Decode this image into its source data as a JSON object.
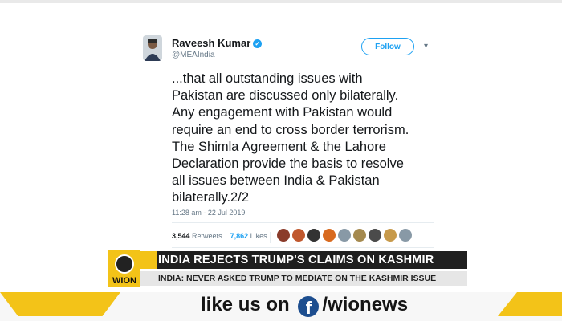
{
  "tweet": {
    "author_name": "Raveesh Kumar",
    "handle": "@MEAIndia",
    "follow_label": "Follow",
    "body_lines": [
      "...that all outstanding issues with",
      "Pakistan are discussed only bilaterally.",
      "Any engagement with Pakistan would",
      "require an end to cross border terrorism.",
      "The Shimla Agreement & the Lahore",
      "Declaration provide the basis to resolve",
      "all issues between India & Pakistan",
      "bilaterally.2/2"
    ],
    "timestamp": "11:28 am - 22 Jul 2019",
    "retweets_count": "3,544",
    "retweets_label": "Retweets",
    "likes_count": "7,862",
    "likes_label": "Likes",
    "icons": {
      "verified": "verified-badge-icon",
      "caret": "chevron-down-icon"
    },
    "liker_colors": [
      "#8a3b2a",
      "#c0582e",
      "#333333",
      "#d86a1f",
      "#8899a6",
      "#a58a4f",
      "#4b4b4b",
      "#c79a4b",
      "#8899a6"
    ]
  },
  "lower_third": {
    "logo_text": "WION",
    "headline": "INDIA REJECTS TRUMP'S CLAIMS ON KASHMIR",
    "subheadline": "INDIA: NEVER ASKED TRUMP TO MEDIATE ON THE KASHMIR ISSUE"
  },
  "promo": {
    "text_before": "like us on",
    "icon": "facebook-icon",
    "text_after": "/wionews"
  },
  "colors": {
    "accent_blue": "#1da1f2",
    "brand_yellow": "#f3c318",
    "bar_dark": "#1f1f1f"
  }
}
